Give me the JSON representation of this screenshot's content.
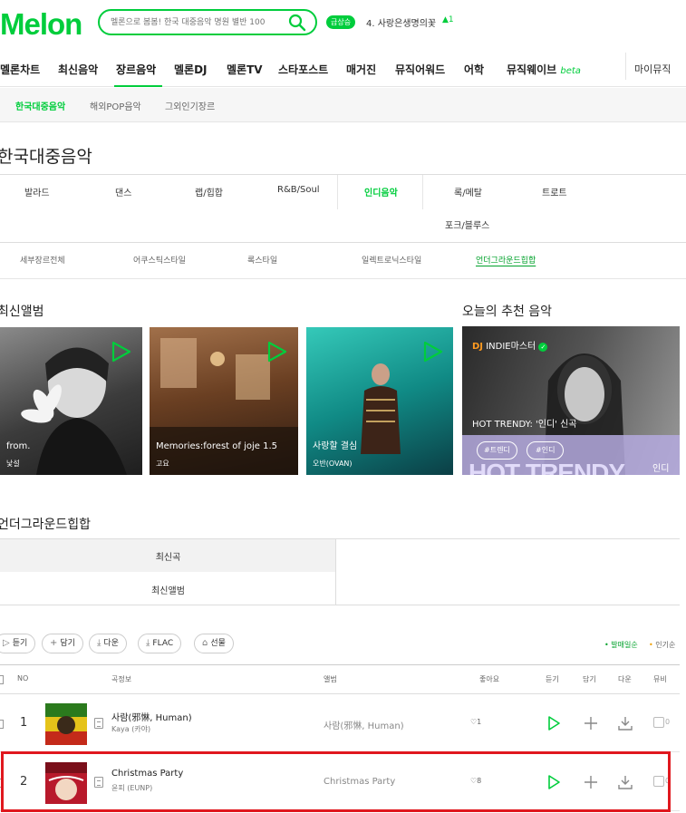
{
  "header": {
    "logo": "Melon",
    "search_placeholder": "멜론으로 봄봄! 한국 대중음악 명원 별반 100",
    "rising_badge": "급상승",
    "rising_text": "4. 사랑은생명의꽃",
    "rising_change": "1"
  },
  "gnb": {
    "items": [
      "멜론차트",
      "최신음악",
      "장르음악",
      "멜론DJ",
      "멜론TV",
      "스타포스트",
      "매거진",
      "뮤직어워드",
      "어학",
      "뮤직웨이브"
    ],
    "beta": "beta",
    "my_music": "마이뮤직"
  },
  "subnav": {
    "items": [
      "한국대중음악",
      "해외POP음악",
      "그외인기장르"
    ]
  },
  "page_title": "한국대중음악",
  "genres": {
    "items": [
      "발라드",
      "댄스",
      "랩/힙합",
      "R&B/Soul",
      "인디음악",
      "록/메탈",
      "트로트",
      "포크/블루스"
    ],
    "detail": [
      "세부장르전체",
      "어쿠스틱스타일",
      "록스타일",
      "일렉트로닉스타일",
      "언더그라운드힙합"
    ]
  },
  "latest_albums": {
    "title": "최신앨범",
    "cards": [
      {
        "title": "from.",
        "artist": "낯설"
      },
      {
        "title": "Memories:forest of joje 1.5",
        "artist": "고요"
      },
      {
        "title": "사랑할 결심",
        "artist": "오반(OVAN)"
      }
    ]
  },
  "recommend": {
    "title": "오늘의 추천 음악",
    "dj_prefix": "DJ",
    "dj_name": "INDIE마스터",
    "headline": "HOT TRENDY: '인디' 신곡",
    "tags": [
      "#트렌디",
      "#인디"
    ],
    "bg_text": "HOT TRENDY",
    "corner_text": "인디"
  },
  "section": {
    "title": "언더그라운드힙합",
    "tabs": [
      "최신곡",
      "최신앨범"
    ]
  },
  "actions": {
    "buttons": [
      "듣기",
      "담기",
      "다운",
      "FLAC",
      "선물"
    ],
    "sort": [
      "발매일순",
      "인기순"
    ]
  },
  "table": {
    "headers": [
      "NO",
      "곡정보",
      "앨범",
      "좋아요",
      "듣기",
      "담기",
      "다운",
      "뮤비"
    ],
    "rows": [
      {
        "no": "1",
        "title": "사람(邪惏, Human)",
        "artist": "Kaya (카야)",
        "album": "사람(邪惏, Human)",
        "likes": "1",
        "mv": "0"
      },
      {
        "no": "2",
        "title": "Christmas Party",
        "artist": "윤피 (EUNP)",
        "album": "Christmas Party",
        "likes": "8",
        "mv": "0"
      }
    ]
  },
  "colors": {
    "accent": "#00cd3c",
    "highlight": "#e0181e"
  }
}
